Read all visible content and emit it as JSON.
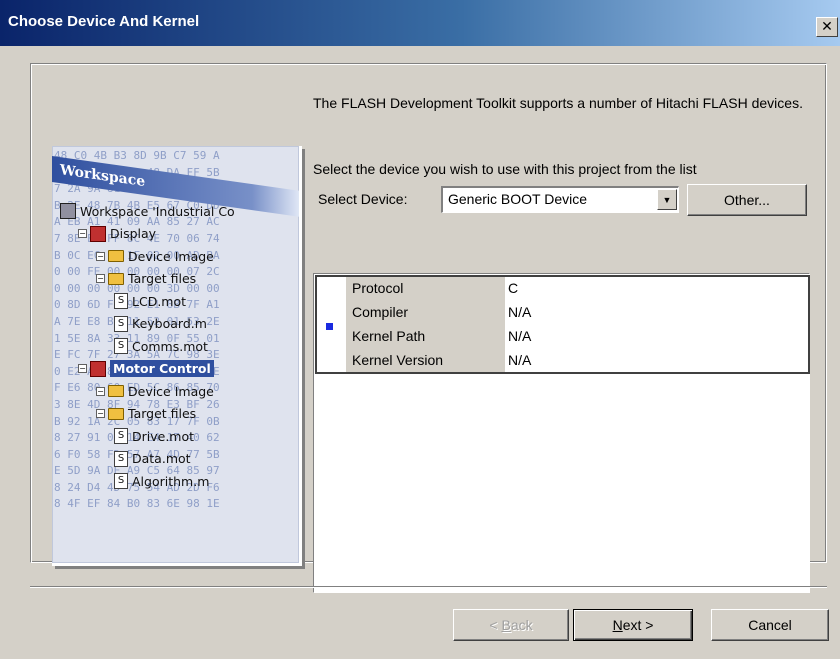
{
  "window": {
    "title": "Choose Device And Kernel",
    "close_symbol": "✕"
  },
  "illustration": {
    "workspace_header": "Workspace",
    "hex_rows": [
      "48 C0 4B B3 8D 9B C7 59 A",
      "5 D0 2D F2 81 48 DA FF 5B",
      "7 2A 9A 81 9A 4D 5D 19 3F",
      "B 2E 48 7B 4B E5 67 C0 DD",
      "A EB A1 41 09 AA 85 27 AC",
      "7 8E E8 FF 8C 4E 70 06 74",
      "B 0C EC F3 1F 02 00 AD BA",
      "0 00 FE 00 00 00 00 07 2C",
      "0 00 00 00 00 00 3D 00 00",
      "0 8D 6D F9 92 E1 8B 7F A1",
      "A 7E E8 B1 11 52 01 53 2E",
      "1 5E 8A 33 11 89 0F 55 01",
      "E FC 7F 27 3A 5A 7C 98 3E",
      "0 E2 AC 82 AD C5 01 3E FE",
      "F E6 80 60 ED 5C 86 85 70",
      "3 8E 4D 8F 94 78 E3 BF 26",
      "B 92 1A 2C 05 83 17 7F 0B",
      "8 27 91 08 14 E4 17 40 62",
      "6 F0 58 FD 57 A7 4D 77 5B",
      "E 5D 9A DE A9 C5 64 85 97",
      "8 24 D4 4D 75 54 AD 2D F6",
      "8 4F EF 84 B0 83 6E 98 1E"
    ],
    "tree": [
      {
        "indent": 0,
        "icon": "workspace-icon",
        "label": "Workspace 'Industrial Co"
      },
      {
        "indent": 1,
        "icon": "project-icon",
        "label": "Display"
      },
      {
        "indent": 2,
        "icon": "folder-icon",
        "label": "Device Image"
      },
      {
        "indent": 2,
        "icon": "folder-icon",
        "label": "Target files"
      },
      {
        "indent": 3,
        "icon": "file-icon",
        "label": "LCD.mot"
      },
      {
        "indent": 3,
        "icon": "file-icon",
        "label": "Keyboard.m"
      },
      {
        "indent": 3,
        "icon": "file-icon",
        "label": "Comms.mot"
      },
      {
        "indent": 1,
        "icon": "project-icon",
        "label": "Motor Control",
        "highlight": true
      },
      {
        "indent": 2,
        "icon": "folder-icon",
        "label": "Device Image"
      },
      {
        "indent": 2,
        "icon": "folder-icon",
        "label": "Target files"
      },
      {
        "indent": 3,
        "icon": "file-icon",
        "label": "Drive.mot"
      },
      {
        "indent": 3,
        "icon": "file-icon",
        "label": "Data.mot"
      },
      {
        "indent": 3,
        "icon": "file-icon",
        "label": "Algorithm.m"
      }
    ]
  },
  "content": {
    "description": "The FLASH Development Toolkit supports a number of Hitachi FLASH devices.",
    "select_hint": "Select the device you wish to use with this project from the list",
    "select_label": "Select Device:",
    "device_value": "Generic BOOT Device",
    "other_button": "Other...",
    "properties": [
      {
        "key": "Protocol",
        "value": "C"
      },
      {
        "key": "Compiler",
        "value": "N/A"
      },
      {
        "key": "Kernel Path",
        "value": "N/A"
      },
      {
        "key": "Kernel Version",
        "value": "N/A"
      }
    ]
  },
  "buttons": {
    "back": {
      "prefix": "< ",
      "accel": "B",
      "rest": "ack"
    },
    "next": {
      "accel": "N",
      "rest": "ext >"
    },
    "cancel": "Cancel"
  },
  "colors": {
    "title_gradient_start": "#0a246a",
    "title_gradient_end": "#a6caf0",
    "dialog_face": "#d4d0c8",
    "selection_marker": "#1a2ae0"
  }
}
